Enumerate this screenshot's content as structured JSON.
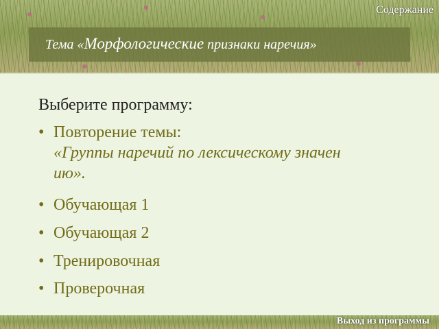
{
  "header": {
    "contents_link": "Содержание",
    "title_prefix": "Тема «",
    "title_main": "Морфологические",
    "title_suffix": " признаки наречия»"
  },
  "main": {
    "prompt": "Выберите программу:",
    "items": [
      {
        "label": "Повторение темы:",
        "subtitle": "«Группы наречий по лексическому значен\nию»."
      },
      {
        "label": "Обучающая 1"
      },
      {
        "label": "Обучающая 2"
      },
      {
        "label": "Тренировочная"
      },
      {
        "label": "Проверочная"
      }
    ],
    "bullet": "•"
  },
  "footer": {
    "exit_link": "Выход из программы"
  },
  "colors": {
    "item_text": "#706c18",
    "panel_bg": "#eef4e2",
    "title_band": "#6e763e"
  }
}
